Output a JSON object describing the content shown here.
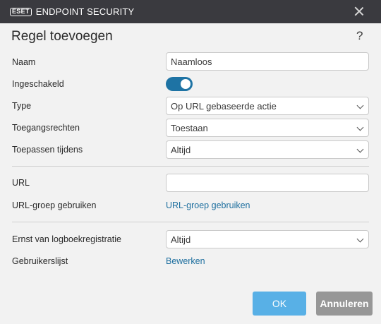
{
  "titlebar": {
    "brand_box": "ESET",
    "brand_text": "ENDPOINT SECURITY"
  },
  "dialog": {
    "title": "Regel toevoegen",
    "help": "?"
  },
  "fields": {
    "naam_label": "Naam",
    "naam_value": "Naamloos",
    "ingeschakeld_label": "Ingeschakeld",
    "ingeschakeld_on": true,
    "type_label": "Type",
    "type_value": "Op URL gebaseerde actie",
    "toegangsrechten_label": "Toegangsrechten",
    "toegangsrechten_value": "Toestaan",
    "toepassen_label": "Toepassen tijdens",
    "toepassen_value": "Altijd",
    "url_label": "URL",
    "url_value": "",
    "urlgroep_label": "URL-groep gebruiken",
    "urlgroep_link": "URL-groep gebruiken",
    "ernst_label": "Ernst van logboekregistratie",
    "ernst_value": "Altijd",
    "gebruikers_label": "Gebruikerslijst",
    "gebruikers_link": "Bewerken"
  },
  "buttons": {
    "ok": "OK",
    "cancel": "Annuleren"
  },
  "colors": {
    "accent": "#1e73a4",
    "link": "#1e6f9f",
    "ok": "#58b0e6",
    "cancel": "#979797",
    "titlebar": "#3a3a3f"
  }
}
